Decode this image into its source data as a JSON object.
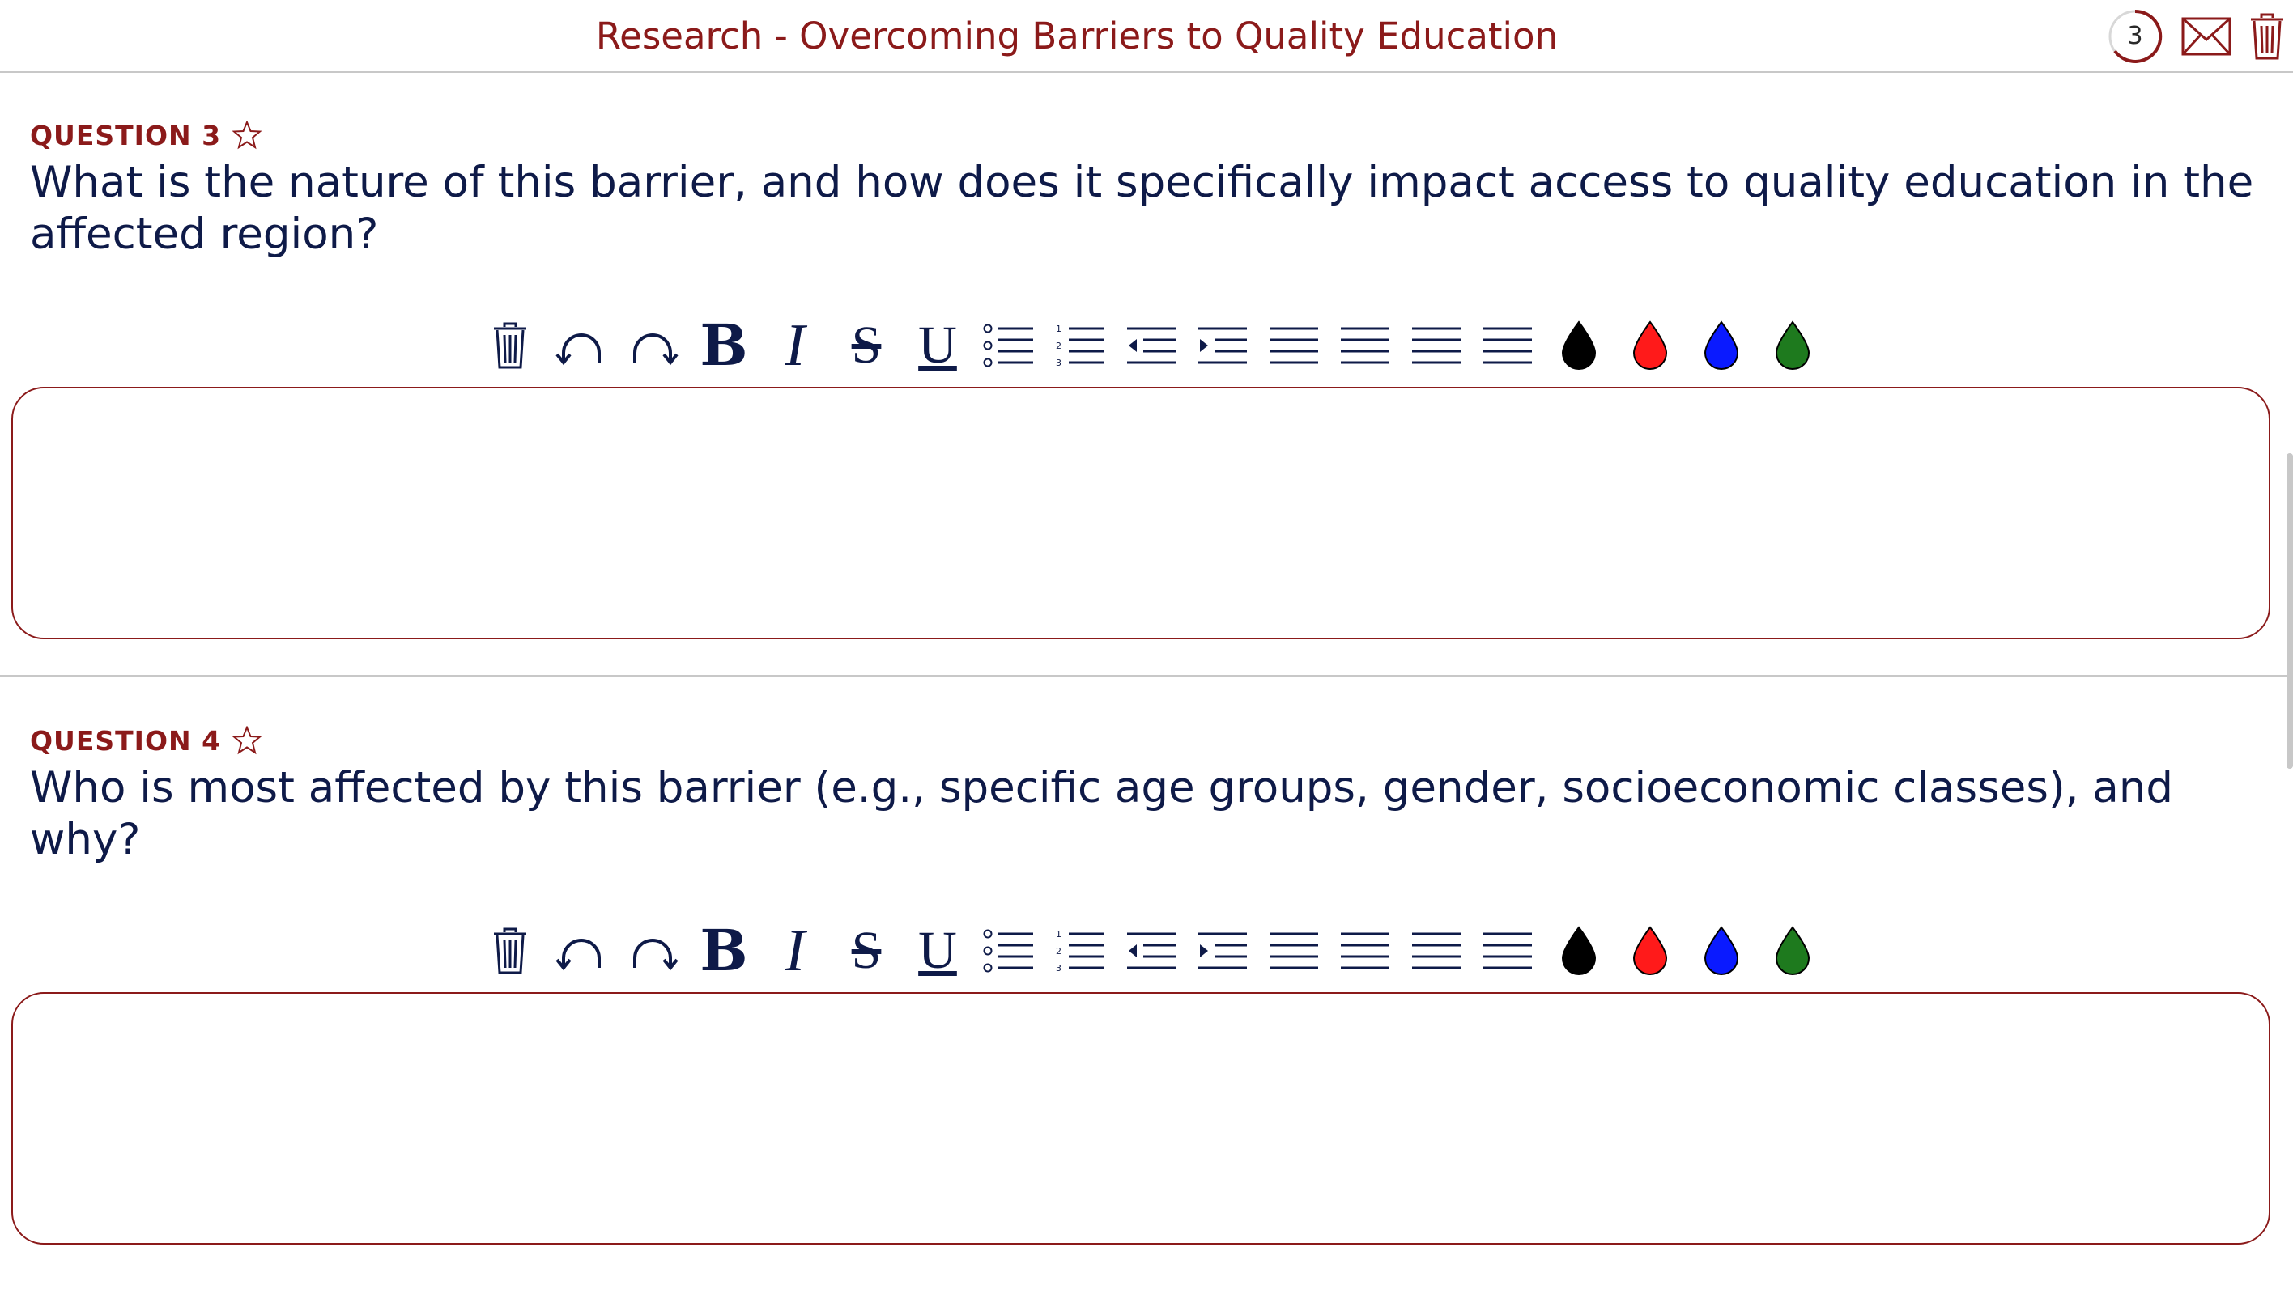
{
  "header": {
    "title": "Research - Overcoming Barriers to Quality Education",
    "badge_count": "3",
    "icons": [
      "progress-ring-icon",
      "mail-icon",
      "trash-icon"
    ]
  },
  "questions": [
    {
      "label": "QUESTION 3",
      "text": "What is the nature of this barrier, and how does it specifically impact access to quality education in the affected region?",
      "answer": ""
    },
    {
      "label": "QUESTION 4",
      "text": "Who is most affected by this barrier (e.g., specific age groups, gender, socioeconomic classes), and why?",
      "answer": ""
    }
  ],
  "toolbar": {
    "bold": "B",
    "italic": "I",
    "strike": "S",
    "underline": "U",
    "icons": [
      "trash-icon",
      "undo-icon",
      "redo-icon",
      "bold-icon",
      "italic-icon",
      "strikethrough-icon",
      "underline-icon",
      "bullet-list-icon",
      "numbered-list-icon",
      "outdent-icon",
      "indent-icon",
      "align-left-icon",
      "align-center-icon",
      "align-right-icon",
      "align-justify-icon",
      "ink-black-icon",
      "ink-red-icon",
      "ink-blue-icon",
      "ink-green-icon"
    ]
  },
  "colors": {
    "brand": "#8b1a1a",
    "text": "#0e1a48",
    "divider": "#c8c8c8",
    "ink_black": "#000000",
    "ink_red": "#ff1a1a",
    "ink_blue": "#0a1aff",
    "ink_green": "#1e7a1e"
  }
}
